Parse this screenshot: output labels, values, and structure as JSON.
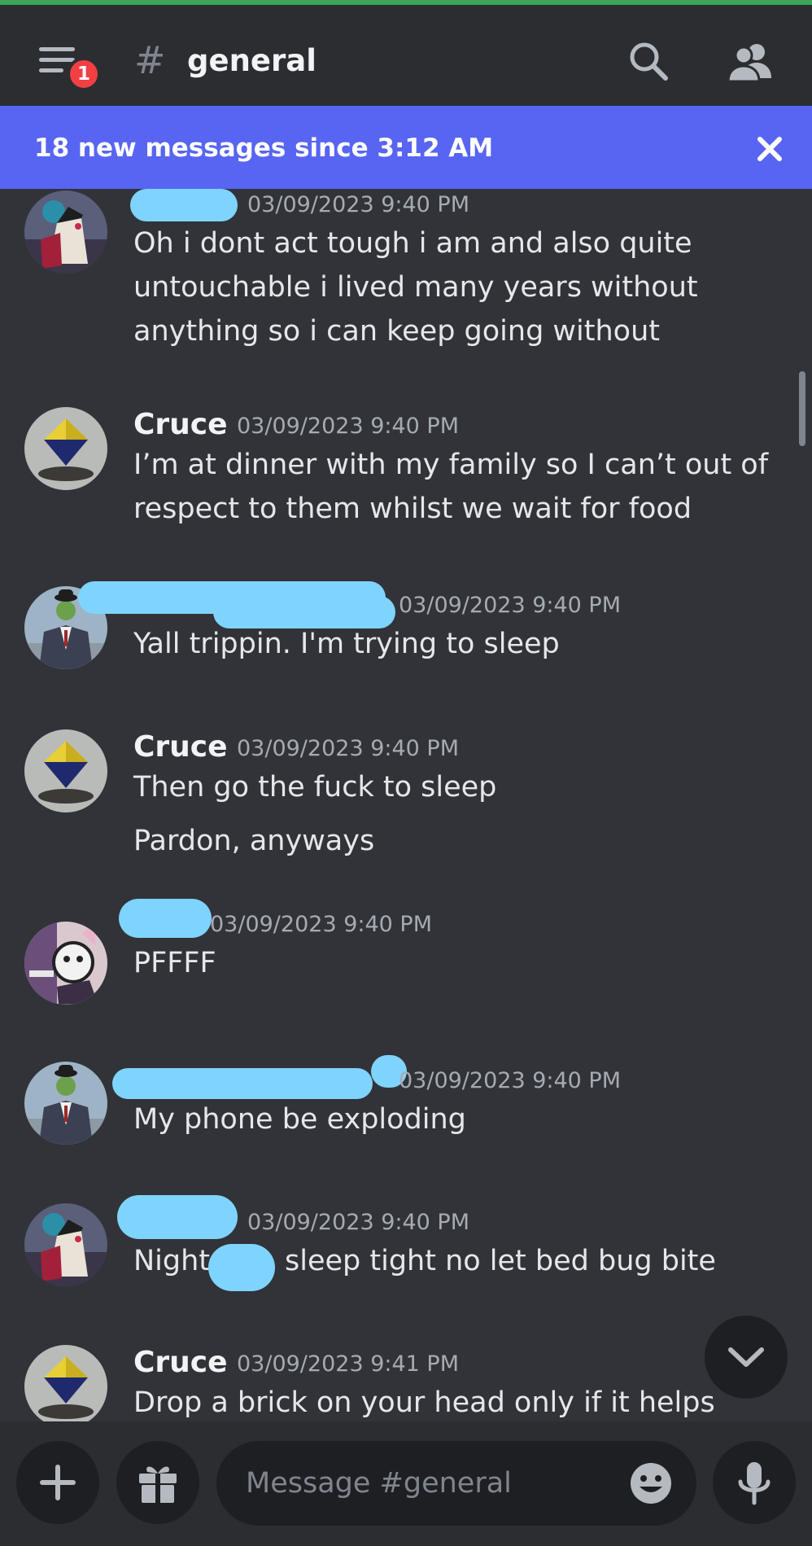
{
  "header": {
    "notification_count": "1",
    "hash_symbol": "#",
    "channel_name": "general"
  },
  "banner": {
    "text": "18 new messages since 3:12 AM"
  },
  "messages": [
    {
      "username": "",
      "timestamp": "03/09/2023 9:40 PM",
      "lines": [
        "Oh i dont act tough i am and also quite",
        "untouchable i lived many years without",
        "anything so i can keep going without"
      ]
    },
    {
      "username": "Cruce",
      "timestamp": "03/09/2023 9:40 PM",
      "lines": [
        "I’m at dinner with my family so I can’t out of",
        "respect to them whilst we wait for food"
      ]
    },
    {
      "username": "",
      "timestamp": "03/09/2023 9:40 PM",
      "lines": [
        "Yall trippin. I'm trying to sleep"
      ]
    },
    {
      "username": "Cruce",
      "timestamp": "03/09/2023 9:40 PM",
      "lines": [
        "Then go the fuck to sleep",
        "Pardon, anyways"
      ]
    },
    {
      "username": "",
      "timestamp": "03/09/2023 9:40 PM",
      "lines": [
        "PFFFF"
      ]
    },
    {
      "username": "",
      "timestamp": "03/09/2023 9:40 PM",
      "lines": [
        "My phone be exploding"
      ]
    },
    {
      "username": "",
      "timestamp": "03/09/2023 9:40 PM",
      "lines": [
        "Night",
        "sleep tight no let bed bug bite"
      ]
    },
    {
      "username": "Cruce",
      "timestamp": "03/09/2023 9:41 PM",
      "lines": [
        "Drop a brick on your head only if it helps"
      ]
    }
  ],
  "composer": {
    "placeholder": "Message #general"
  },
  "colors": {
    "background": "#313338",
    "header": "#2b2d31",
    "banner": "#5865f2",
    "badge": "#f23f43",
    "redaction": "#7fd3ff",
    "accent_top": "#3ba55c"
  },
  "icons": [
    "menu-icon",
    "hash-icon",
    "search-icon",
    "members-icon",
    "close-icon",
    "chevron-down-icon",
    "plus-icon",
    "gift-icon",
    "emoji-icon",
    "microphone-icon"
  ]
}
